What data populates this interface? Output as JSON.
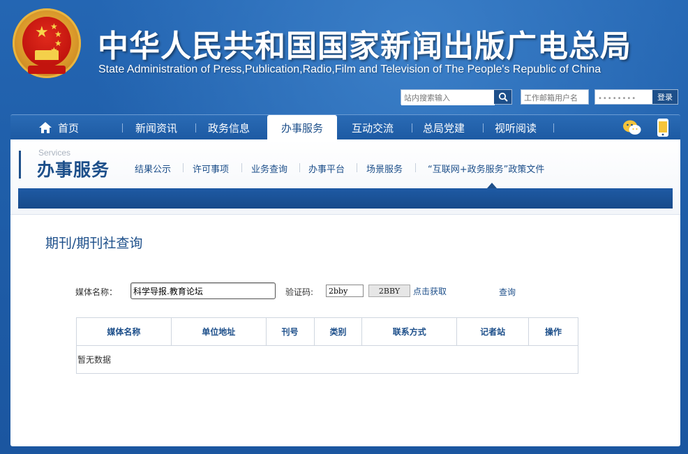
{
  "header": {
    "title": "中华人民共和国国家新闻出版广电总局",
    "subtitle": "State Administration of Press,Publication,Radio,Film and Television of The People's Republic of China",
    "search_placeholder": "站内搜索输入",
    "mail_placeholder": "工作邮箱用户名",
    "password_value": "••••••••",
    "login_label": "登录"
  },
  "nav": {
    "items": [
      {
        "label": "首页"
      },
      {
        "label": "新闻资讯"
      },
      {
        "label": "政务信息"
      },
      {
        "label": "办事服务"
      },
      {
        "label": "互动交流"
      },
      {
        "label": "总局党建"
      },
      {
        "label": "视听阅读"
      }
    ],
    "active": "办事服务"
  },
  "services": {
    "en": "Services",
    "cn": "办事服务",
    "sub_nav": [
      {
        "label": "结果公示"
      },
      {
        "label": "许可事项"
      },
      {
        "label": "业务查询"
      },
      {
        "label": "办事平台"
      },
      {
        "label": "场景服务"
      },
      {
        "label": "“互联网+政务服务”政策文件"
      }
    ]
  },
  "query": {
    "page_title": "期刊/期刊社查询",
    "media_label": "媒体名称：",
    "media_value": "科学导报.教育论坛",
    "captcha_label": "验证码:",
    "captcha_value": "2bby",
    "captcha_image_text": "2BBY",
    "refresh_label": "点击获取",
    "search_label": "查询"
  },
  "table": {
    "headers": [
      "媒体名称",
      "单位地址",
      "刊号",
      "类别",
      "联系方式",
      "记者站",
      "操作"
    ],
    "empty_text": "暂无数据"
  },
  "colors": {
    "brand_blue": "#1d4f8a",
    "background": "#1f5ea9",
    "emblem_red": "#c2140e",
    "emblem_gold": "#f4d04a"
  }
}
